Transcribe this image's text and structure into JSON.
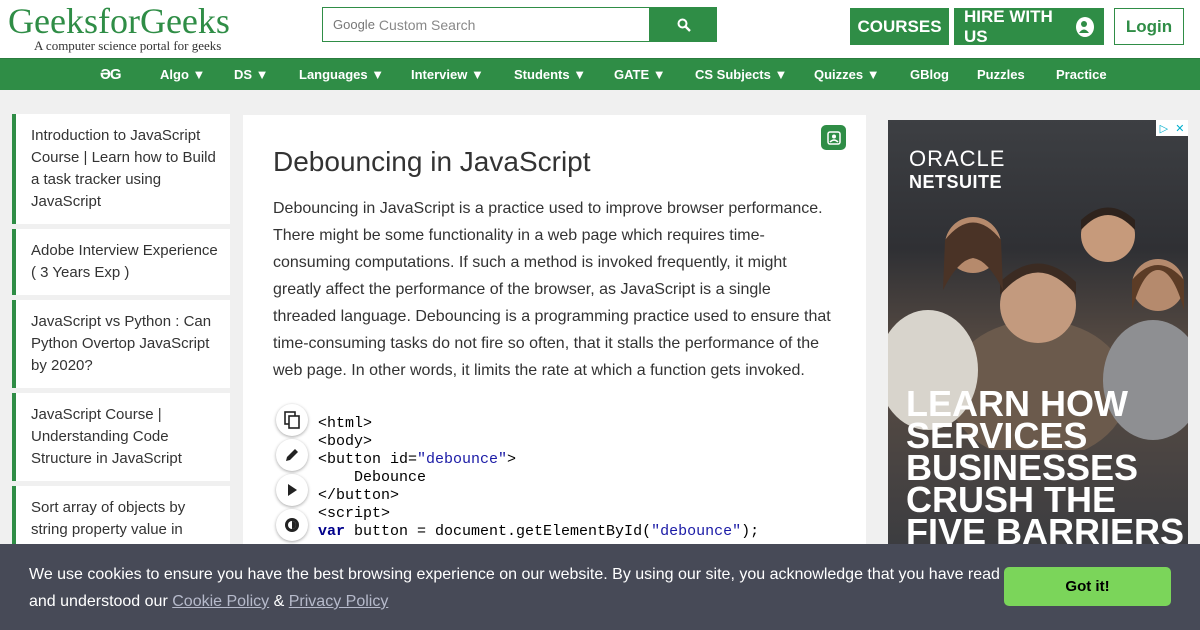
{
  "header": {
    "logo_title": "GeeksforGeeks",
    "logo_tagline": "A computer science portal for geeks",
    "search_brand": "Google",
    "search_placeholder": "Custom Search",
    "courses_label": "COURSES",
    "hire_label": "HIRE WITH US",
    "login_label": "Login"
  },
  "nav": {
    "logo": "ƏG",
    "items": [
      "Algo ▼",
      "DS ▼",
      "Languages ▼",
      "Interview ▼",
      "Students ▼",
      "GATE ▼",
      "CS Subjects ▼",
      "Quizzes ▼",
      "GBlog",
      "Puzzles",
      "Practice"
    ]
  },
  "sidebar": {
    "items": [
      "Introduction to JavaScript Course | Learn how to Build a task tracker using JavaScript",
      "Adobe Interview Experience ( 3 Years Exp )",
      "JavaScript vs Python : Can Python Overtop JavaScript by 2020?",
      "JavaScript Course | Understanding Code Structure in JavaScript",
      "Sort array of objects by string property value in"
    ]
  },
  "article": {
    "title": "Debouncing in JavaScript",
    "body": "Debouncing in JavaScript is a practice used to improve browser performance. There might be some functionality in a web page which requires time-consuming computations. If such a method is invoked frequently, it might greatly affect the performance of the browser, as JavaScript is a single threaded language. Debouncing is a programming practice used to ensure that time-consuming tasks do not fire so often, that it stalls the performance of the web page. In other words, it limits the rate at which a function gets invoked.",
    "code": {
      "l1": "<html>",
      "l2": "<body>",
      "l3a": "<button id=",
      "l3b": "\"debounce\"",
      "l3c": ">",
      "l4": "    Debounce",
      "l5": "</button>",
      "l6": "<script>",
      "l7a": "var",
      "l7b": " button = document.getElementById(",
      "l7c": "\"debounce\"",
      "l7d": ");"
    }
  },
  "ad": {
    "brand": "ORACLE",
    "product": "NETSUITE",
    "headline": "LEARN HOW SERVICES BUSINESSES CRUSH THE FIVE BARRIERS"
  },
  "cookie": {
    "text": "We use cookies to ensure you have the best browsing experience on our website. By using our site, you acknowledge that you have read and understood our",
    "cookie_policy": "Cookie Policy",
    "amp": "&",
    "privacy_policy": "Privacy Policy",
    "button": "Got it!"
  },
  "colors": {
    "brand_green": "#2f8d46",
    "cookie_bg": "#474a57",
    "cookie_button": "#7bd55a"
  }
}
